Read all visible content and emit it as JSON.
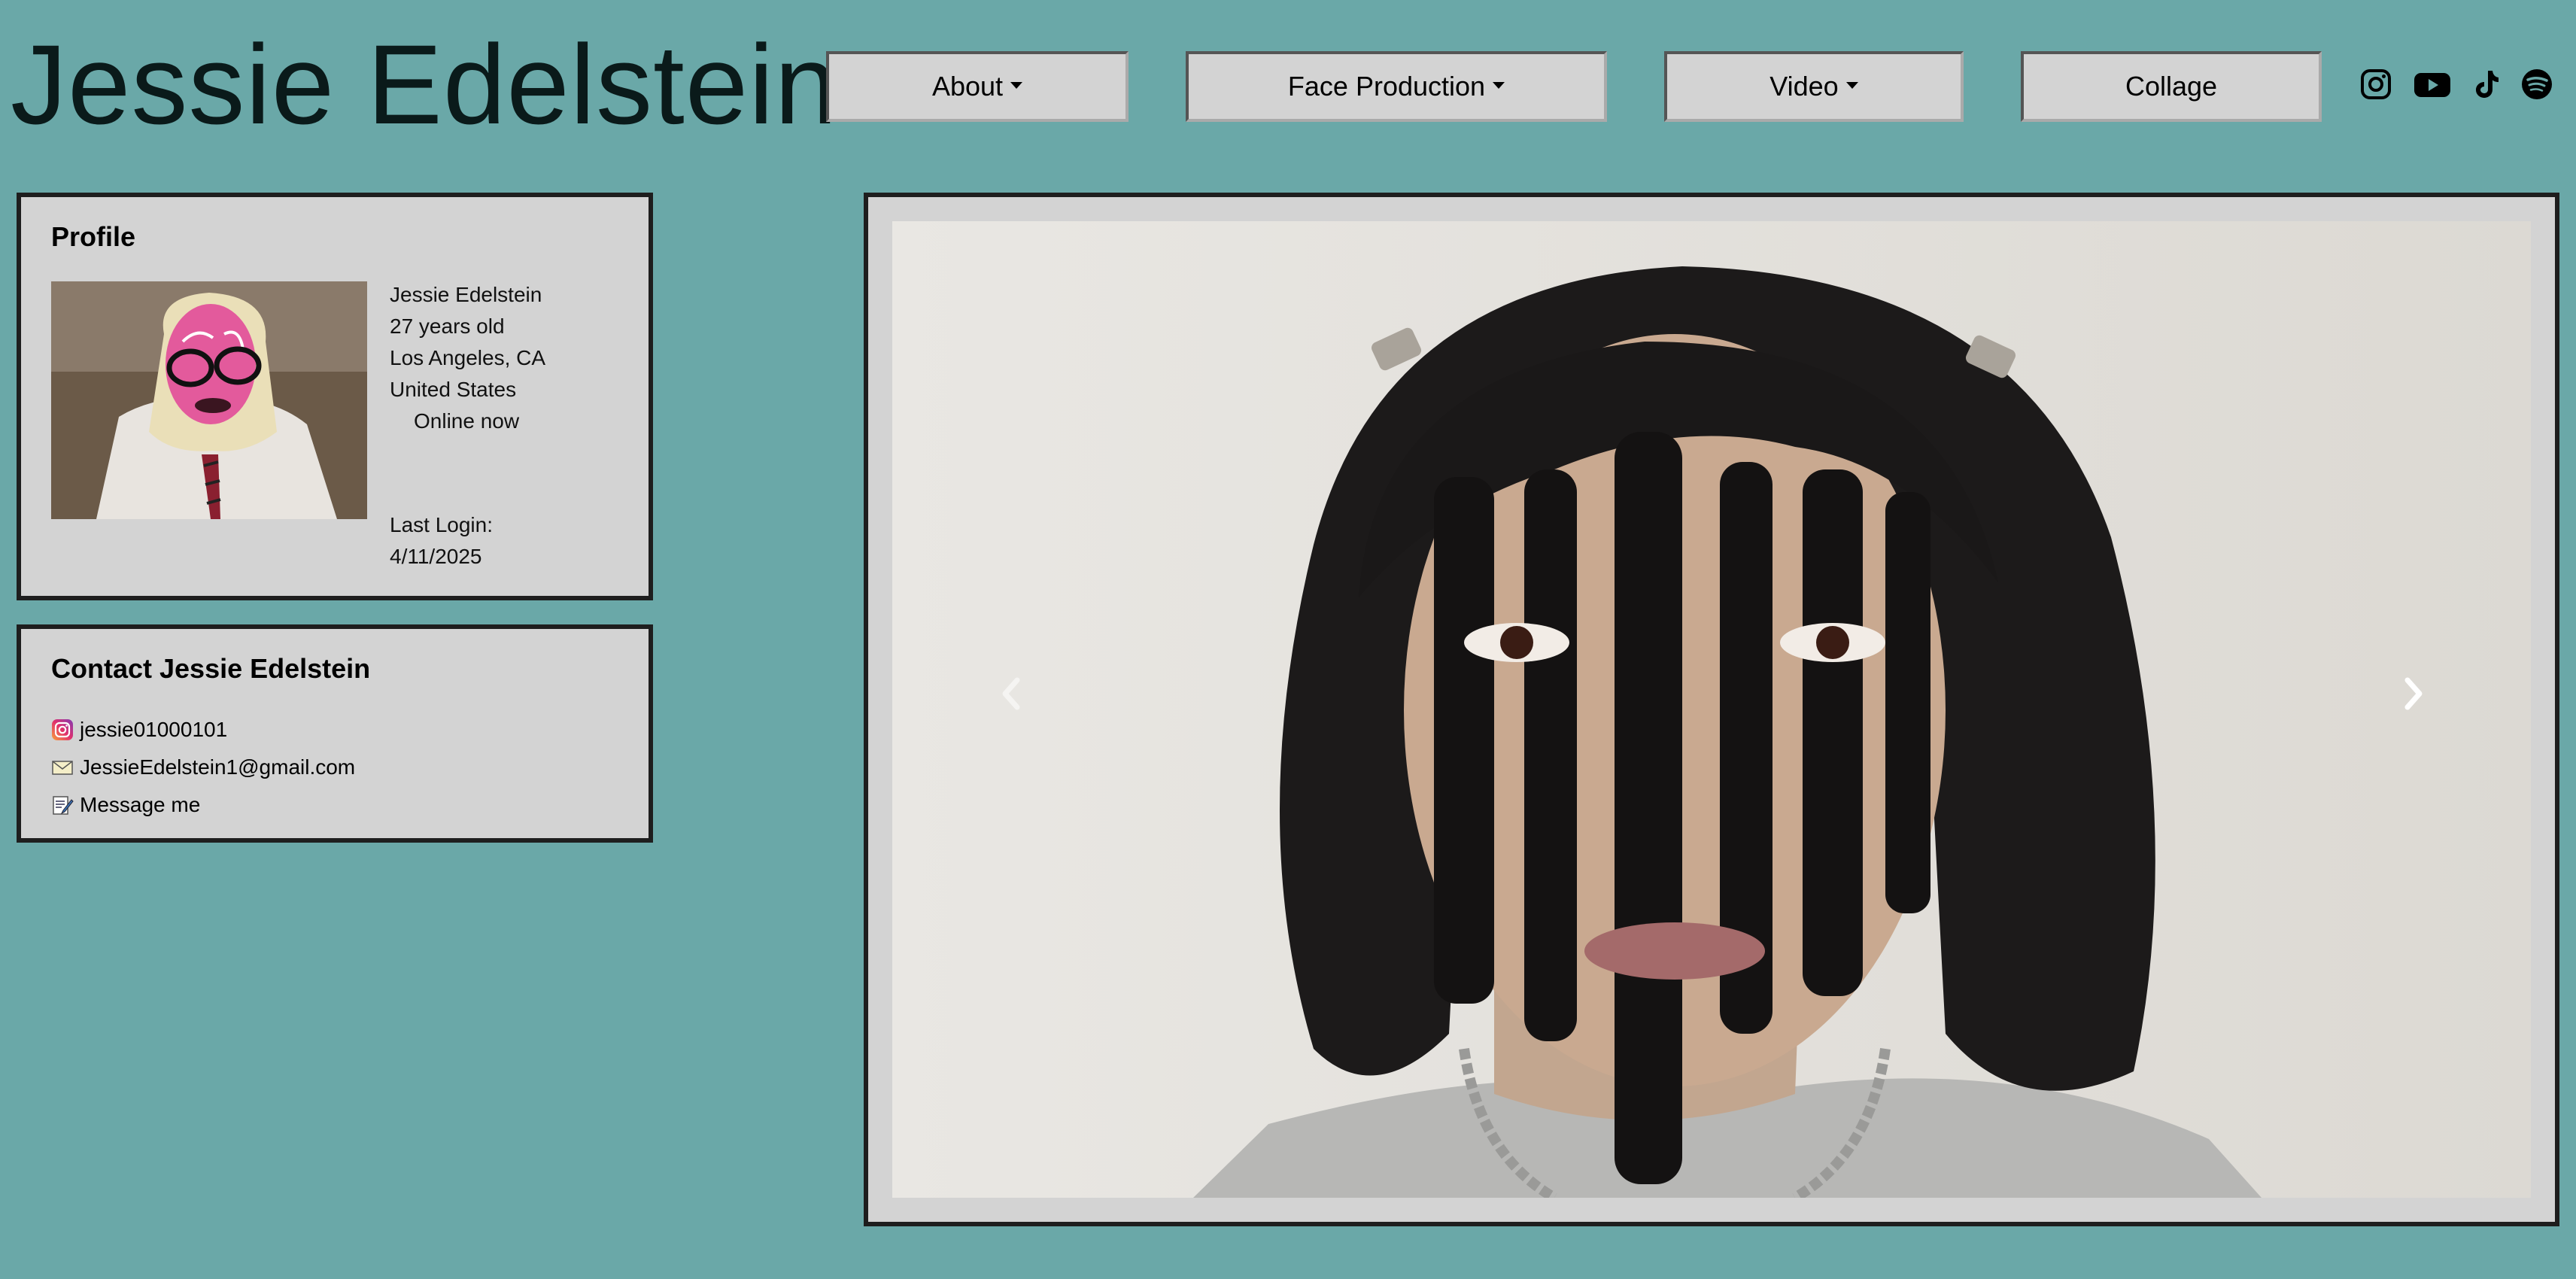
{
  "site": {
    "title": "Jessie Edelstein"
  },
  "nav": {
    "about": "About",
    "face_production": "Face Production",
    "video": "Video",
    "collage": "Collage"
  },
  "social_icons": [
    "instagram-icon",
    "youtube-icon",
    "tiktok-icon",
    "spotify-icon"
  ],
  "profile": {
    "heading": "Profile",
    "name": "Jessie Edelstein",
    "age": "27 years old",
    "city": "Los Angeles, CA",
    "country": "United States",
    "status": "Online now",
    "last_login_label": "Last Login:",
    "last_login_date": "4/11/2025"
  },
  "contact": {
    "heading": "Contact Jessie Edelstein",
    "instagram": "jessie01000101",
    "email": "JessieEdelstein1@gmail.com",
    "message": "Message me"
  },
  "colors": {
    "background": "#6aa8a8",
    "panel": "#d3d3d3",
    "border": "#1e1e1e"
  }
}
